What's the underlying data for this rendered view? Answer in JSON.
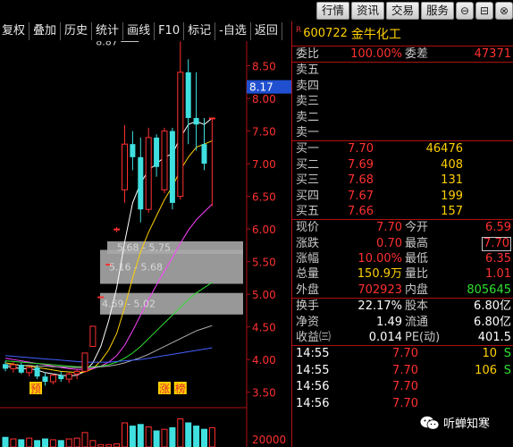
{
  "window_buttons": [
    "行情",
    "资讯",
    "交易",
    "服务"
  ],
  "toolbar": [
    "复权",
    "叠加",
    "历史",
    "统计",
    "画线",
    "F10",
    "标记",
    "-自选",
    "返回"
  ],
  "stock": {
    "flag": "R",
    "code": "600722",
    "name": "金牛化工"
  },
  "weibi": {
    "label": "委比",
    "value": "100.00%",
    "label2": "委差",
    "value2": "47371"
  },
  "asks": [
    {
      "label": "卖五",
      "price": "",
      "qty": ""
    },
    {
      "label": "卖四",
      "price": "",
      "qty": ""
    },
    {
      "label": "卖三",
      "price": "",
      "qty": ""
    },
    {
      "label": "卖二",
      "price": "",
      "qty": ""
    },
    {
      "label": "卖一",
      "price": "",
      "qty": ""
    }
  ],
  "bids": [
    {
      "label": "买一",
      "price": "7.70",
      "qty": "46476"
    },
    {
      "label": "买二",
      "price": "7.69",
      "qty": "408"
    },
    {
      "label": "买三",
      "price": "7.68",
      "qty": "131"
    },
    {
      "label": "买四",
      "price": "7.67",
      "qty": "199"
    },
    {
      "label": "买五",
      "price": "7.66",
      "qty": "157"
    }
  ],
  "quote": [
    {
      "l1": "现价",
      "v1": "7.70",
      "l2": "今开",
      "v2": "6.59",
      "c1": "red",
      "c2": "red"
    },
    {
      "l1": "涨跌",
      "v1": "0.70",
      "l2": "最高",
      "v2": "7.70",
      "c1": "red",
      "c2": "red",
      "hl2": true
    },
    {
      "l1": "涨幅",
      "v1": "10.00%",
      "l2": "最低",
      "v2": "6.35",
      "c1": "red",
      "c2": "red"
    },
    {
      "l1": "总量",
      "v1": "150.9万",
      "l2": "量比",
      "v2": "1.01",
      "c1": "yel",
      "c2": "red"
    },
    {
      "l1": "外盘",
      "v1": "702923",
      "l2": "内盘",
      "v2": "805645",
      "c1": "red",
      "c2": "grn"
    }
  ],
  "fund": [
    {
      "l1": "换手",
      "v1": "22.17%",
      "l2": "股本",
      "v2": "6.80亿"
    },
    {
      "l1": "净资",
      "v1": "1.49",
      "l2": "流通",
      "v2": "6.80亿"
    },
    {
      "l1": "收益㈢",
      "v1": "0.014",
      "l2": "PE(动)",
      "v2": "401.5"
    }
  ],
  "ticks": [
    {
      "time": "14:55",
      "price": "7.70",
      "vol": "10",
      "flag": "S"
    },
    {
      "time": "14:55",
      "price": "7.70",
      "vol": "106",
      "flag": "S"
    },
    {
      "time": "14:56",
      "price": "7.70",
      "vol": "",
      "flag": ""
    },
    {
      "time": "14:56",
      "price": "7.70",
      "vol": "",
      "flag": ""
    }
  ],
  "watermark": "听蝉知寒",
  "chart_data": {
    "type": "candlestick",
    "y_axis_ticks": [
      "8.50",
      "8.00",
      "7.50",
      "7.00",
      "6.50",
      "6.00",
      "5.50",
      "5.00",
      "4.50",
      "4.00",
      "3.50"
    ],
    "ylim": [
      3.4,
      8.85
    ],
    "current_price_label": "8.17",
    "volume_axis_label": "20000",
    "annotations": [
      {
        "text": "8.87",
        "x_index": 17,
        "price": 8.87
      },
      {
        "text": "5.68 - 5.75",
        "price": 5.72
      },
      {
        "text": "5.16 - 5.68",
        "price": 5.42
      },
      {
        "text": "4.69 - 5.02",
        "price": 4.86
      }
    ],
    "gap_zones": [
      {
        "low": 5.68,
        "high": 5.75
      },
      {
        "low": 5.16,
        "high": 5.68
      },
      {
        "low": 4.69,
        "high": 5.02
      }
    ],
    "bottom_markers": [
      {
        "text": "预",
        "x_index": 0
      },
      {
        "text": "涨",
        "x_index": 20
      },
      {
        "text": "榜",
        "x_index": 22
      }
    ],
    "candles": [
      {
        "o": 3.93,
        "h": 3.98,
        "l": 3.82,
        "c": 3.86
      },
      {
        "o": 3.86,
        "h": 3.96,
        "l": 3.8,
        "c": 3.92
      },
      {
        "o": 3.92,
        "h": 3.95,
        "l": 3.78,
        "c": 3.8
      },
      {
        "o": 3.8,
        "h": 3.9,
        "l": 3.74,
        "c": 3.88
      },
      {
        "o": 3.88,
        "h": 3.92,
        "l": 3.7,
        "c": 3.74
      },
      {
        "o": 3.74,
        "h": 3.8,
        "l": 3.6,
        "c": 3.66
      },
      {
        "o": 3.66,
        "h": 3.78,
        "l": 3.62,
        "c": 3.76
      },
      {
        "o": 3.76,
        "h": 3.82,
        "l": 3.66,
        "c": 3.7
      },
      {
        "o": 3.7,
        "h": 3.8,
        "l": 3.64,
        "c": 3.78
      },
      {
        "o": 3.78,
        "h": 3.84,
        "l": 3.7,
        "c": 3.82
      },
      {
        "o": 3.82,
        "h": 4.1,
        "l": 3.8,
        "c": 4.1
      },
      {
        "o": 4.2,
        "h": 4.51,
        "l": 4.2,
        "c": 4.51
      },
      {
        "o": 4.96,
        "h": 4.96,
        "l": 4.96,
        "c": 4.96
      },
      {
        "o": 5.46,
        "h": 5.46,
        "l": 5.46,
        "c": 5.46
      },
      {
        "o": 6.0,
        "h": 6.03,
        "l": 5.95,
        "c": 6.0
      },
      {
        "o": 6.6,
        "h": 7.59,
        "l": 6.4,
        "c": 7.3
      },
      {
        "o": 7.3,
        "h": 7.5,
        "l": 6.9,
        "c": 7.1
      },
      {
        "o": 7.1,
        "h": 7.4,
        "l": 6.1,
        "c": 6.3
      },
      {
        "o": 6.3,
        "h": 7.55,
        "l": 6.25,
        "c": 7.4
      },
      {
        "o": 7.4,
        "h": 7.45,
        "l": 6.8,
        "c": 6.95
      },
      {
        "o": 6.6,
        "h": 7.55,
        "l": 6.55,
        "c": 7.5
      },
      {
        "o": 7.5,
        "h": 7.55,
        "l": 6.3,
        "c": 6.4
      },
      {
        "o": 6.5,
        "h": 8.87,
        "l": 6.45,
        "c": 8.4
      },
      {
        "o": 8.4,
        "h": 8.6,
        "l": 7.3,
        "c": 7.7
      },
      {
        "o": 7.7,
        "h": 8.4,
        "l": 7.2,
        "c": 7.6
      },
      {
        "o": 7.3,
        "h": 7.7,
        "l": 6.9,
        "c": 7.0
      },
      {
        "o": 7.7,
        "h": 7.7,
        "l": 6.35,
        "c": 7.7
      }
    ],
    "ma_lines": [
      {
        "color": "#ffffff",
        "values": [
          3.9,
          3.88,
          3.86,
          3.86,
          3.84,
          3.8,
          3.78,
          3.76,
          3.75,
          3.76,
          3.82,
          3.95,
          4.2,
          4.6,
          5.1,
          5.8,
          6.4,
          6.7,
          6.9,
          7.0,
          7.1,
          7.15,
          7.4,
          7.6,
          7.65,
          7.6,
          7.7
        ]
      },
      {
        "color": "#ffd000",
        "values": [
          3.95,
          3.93,
          3.91,
          3.9,
          3.88,
          3.86,
          3.84,
          3.82,
          3.81,
          3.8,
          3.81,
          3.86,
          3.98,
          4.15,
          4.4,
          4.8,
          5.25,
          5.65,
          5.95,
          6.2,
          6.45,
          6.65,
          6.9,
          7.1,
          7.25,
          7.3,
          7.35
        ]
      },
      {
        "color": "#ff40ff",
        "values": [
          4.02,
          4.0,
          3.98,
          3.96,
          3.94,
          3.92,
          3.9,
          3.88,
          3.86,
          3.85,
          3.85,
          3.86,
          3.9,
          3.96,
          4.06,
          4.22,
          4.44,
          4.68,
          4.92,
          5.14,
          5.36,
          5.56,
          5.78,
          5.98,
          6.14,
          6.26,
          6.38
        ]
      },
      {
        "color": "#30e030",
        "values": [
          3.98,
          3.97,
          3.96,
          3.95,
          3.94,
          3.93,
          3.92,
          3.91,
          3.9,
          3.89,
          3.89,
          3.89,
          3.9,
          3.92,
          3.96,
          4.02,
          4.1,
          4.2,
          4.32,
          4.44,
          4.56,
          4.68,
          4.8,
          4.92,
          5.02,
          5.1,
          5.18
        ]
      },
      {
        "color": "#b0b0b0",
        "values": [
          3.92,
          3.92,
          3.91,
          3.91,
          3.9,
          3.9,
          3.89,
          3.89,
          3.88,
          3.88,
          3.88,
          3.88,
          3.89,
          3.9,
          3.92,
          3.95,
          3.99,
          4.03,
          4.08,
          4.14,
          4.2,
          4.26,
          4.32,
          4.38,
          4.44,
          4.48,
          4.52
        ]
      },
      {
        "color": "#4060ff",
        "values": [
          4.06,
          4.05,
          4.04,
          4.03,
          4.02,
          4.01,
          4.0,
          3.99,
          3.98,
          3.97,
          3.96,
          3.96,
          3.96,
          3.96,
          3.97,
          3.98,
          3.99,
          4.0,
          4.02,
          4.04,
          4.06,
          4.08,
          4.1,
          4.12,
          4.14,
          4.16,
          4.18
        ]
      }
    ],
    "volume": [
      12,
      10,
      9,
      11,
      8,
      10,
      9,
      8,
      10,
      11,
      18,
      8,
      3,
      3,
      4,
      30,
      26,
      28,
      25,
      20,
      22,
      24,
      35,
      30,
      26,
      22,
      24
    ]
  }
}
